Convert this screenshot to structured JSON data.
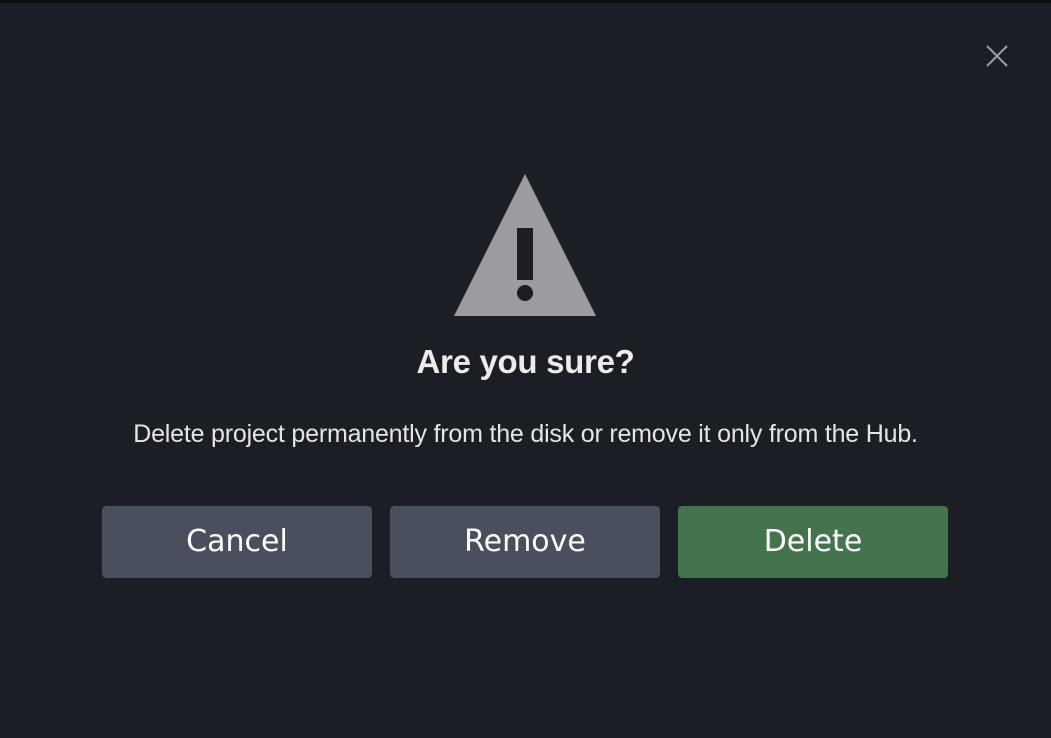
{
  "dialog": {
    "title": "Are you sure?",
    "message": "Delete project permanently from the disk or remove it only from the Hub.",
    "icon": "warning-triangle-icon",
    "close_icon": "close-icon"
  },
  "buttons": {
    "cancel_label": "Cancel",
    "remove_label": "Remove",
    "delete_label": "Delete"
  },
  "colors": {
    "background": "#1c1e26",
    "secondary_button": "#4a4f5e",
    "primary_button": "#44744c",
    "icon": "#9b9ca1"
  }
}
